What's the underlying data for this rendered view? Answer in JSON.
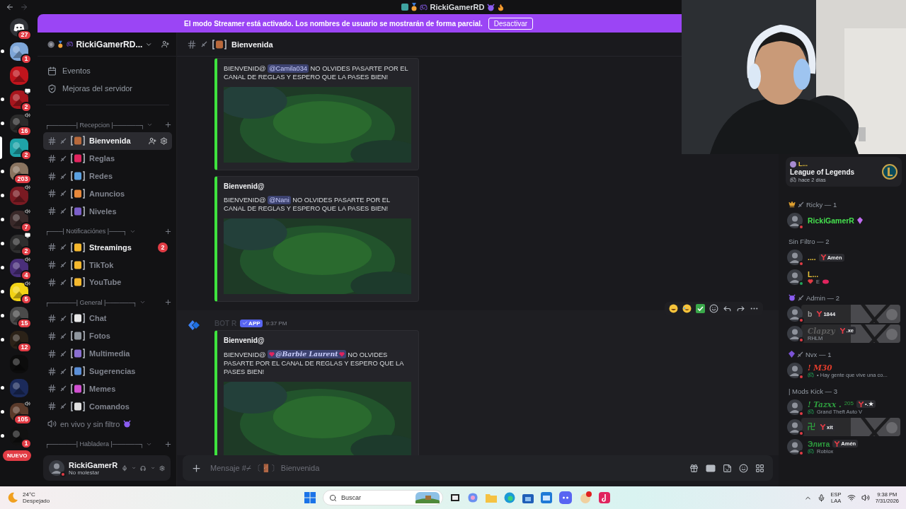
{
  "window": {
    "title": "RickiGamerRD"
  },
  "servers": [
    {
      "kind": "home",
      "badge": "27",
      "unread": false,
      "selected": false,
      "speaker": false,
      "screen": false,
      "color": "#313338"
    },
    {
      "kind": "server",
      "badge": "1",
      "unread": true,
      "selected": false,
      "speaker": false,
      "screen": false,
      "color": "#7ea6d8"
    },
    {
      "kind": "server",
      "unread": false,
      "selected": false,
      "speaker": false,
      "screen": false,
      "color": "#c0141c"
    },
    {
      "kind": "server",
      "badge": "2",
      "unread": true,
      "selected": false,
      "speaker": false,
      "screen": true,
      "color": "#a8161e"
    },
    {
      "kind": "server",
      "badge": "16",
      "unread": true,
      "selected": false,
      "speaker": true,
      "screen": false,
      "color": "#2a2a2a"
    },
    {
      "kind": "server",
      "badge": "2",
      "unread": false,
      "selected": true,
      "speaker": false,
      "screen": false,
      "color": "#1fa3a8"
    },
    {
      "kind": "server",
      "badge": "203",
      "unread": true,
      "selected": false,
      "speaker": false,
      "screen": false,
      "color": "#8a7460"
    },
    {
      "kind": "server",
      "unread": true,
      "selected": false,
      "speaker": true,
      "screen": false,
      "color": "#7a1a22"
    },
    {
      "kind": "server",
      "badge": "7",
      "unread": true,
      "selected": false,
      "speaker": true,
      "screen": false,
      "color": "#3a2a2a"
    },
    {
      "kind": "server",
      "badge": "2",
      "unread": true,
      "selected": false,
      "speaker": false,
      "screen": true,
      "color": "#2e2e2e"
    },
    {
      "kind": "server",
      "badge": "4",
      "unread": true,
      "selected": false,
      "speaker": true,
      "screen": false,
      "color": "#4a2f7a"
    },
    {
      "kind": "server",
      "badge": "5",
      "unread": true,
      "selected": false,
      "speaker": true,
      "screen": false,
      "color": "#f2d316"
    },
    {
      "kind": "server",
      "badge": "15",
      "unread": true,
      "selected": false,
      "speaker": false,
      "screen": false,
      "color": "#4a4a4a"
    },
    {
      "kind": "server",
      "badge": "12",
      "unread": true,
      "selected": false,
      "speaker": false,
      "screen": false,
      "color": "#2b2218"
    },
    {
      "kind": "server",
      "unread": false,
      "selected": false,
      "speaker": false,
      "screen": false,
      "color": "#0c0c0c"
    },
    {
      "kind": "server",
      "unread": true,
      "selected": false,
      "speaker": false,
      "screen": false,
      "color": "#1b2a5a"
    },
    {
      "kind": "server",
      "badge": "105",
      "unread": true,
      "selected": false,
      "speaker": true,
      "screen": false,
      "color": "#5a3a2a"
    },
    {
      "kind": "server",
      "badge": "1",
      "unread": true,
      "selected": false,
      "speaker": false,
      "screen": false,
      "color": "#111111"
    }
  ],
  "new_label": "NUEVO",
  "banner": {
    "text": "El modo Streamer está activado. Los nombres de usuario se mostrarán de forma parcial.",
    "button": "Desactivar"
  },
  "server_header": {
    "name": "RickiGamerRD..."
  },
  "nav": [
    {
      "kind": "events",
      "label": "Eventos"
    },
    {
      "kind": "boost",
      "label": "Mejoras del servidor"
    }
  ],
  "categories": [
    {
      "label": "┌──────| Recepcion |──────┐",
      "expanded": true,
      "channels": [
        {
          "kind": "text",
          "name": "Bienvenida",
          "color": "#b8693c",
          "selected": true,
          "unread": false
        },
        {
          "kind": "text",
          "name": "Reglas",
          "color": "#e0245e",
          "selected": false,
          "unread": false
        },
        {
          "kind": "text",
          "name": "Redes",
          "color": "#5aa0e0",
          "selected": false,
          "unread": false
        },
        {
          "kind": "text",
          "name": "Anuncios",
          "color": "#e8893b",
          "selected": false,
          "unread": false
        },
        {
          "kind": "text",
          "name": "Niveles",
          "color": "#7b5fc9",
          "selected": false,
          "unread": false
        }
      ]
    },
    {
      "label": "┌───| Notificaciónes |───┐",
      "expanded": true,
      "channels": [
        {
          "kind": "text",
          "name": "Streamings",
          "color": "#f5b82e",
          "selected": false,
          "unread": true,
          "badge": "2"
        },
        {
          "kind": "text",
          "name": "TikTok",
          "color": "#f5b82e",
          "selected": false,
          "unread": false
        },
        {
          "kind": "text",
          "name": "YouTube",
          "color": "#f5b82e",
          "selected": false,
          "unread": false
        }
      ]
    },
    {
      "label": "┌──────| General |──────┐",
      "expanded": true,
      "channels": [
        {
          "kind": "text",
          "name": "Chat",
          "color": "#e8e8e8",
          "selected": false,
          "unread": false
        },
        {
          "kind": "text",
          "name": "Fotos",
          "color": "#8f969e",
          "selected": false,
          "unread": false
        },
        {
          "kind": "text",
          "name": "Multimedia",
          "color": "#8a6fd1",
          "selected": false,
          "unread": false
        },
        {
          "kind": "text",
          "name": "Sugerencias",
          "color": "#5b8fd8",
          "selected": false,
          "unread": false
        },
        {
          "kind": "text",
          "name": "Memes",
          "color": "#d04fd0",
          "selected": false,
          "unread": false
        },
        {
          "kind": "text",
          "name": "Comandos",
          "color": "#e0e0e0",
          "selected": false,
          "unread": false
        },
        {
          "kind": "voice",
          "name": "en vivo y sin filtro",
          "selected": false,
          "unread": false
        }
      ]
    },
    {
      "label": "┌──────| Habladera |──────┐",
      "expanded": true
    }
  ],
  "user_panel": {
    "name": "RickiGamerR",
    "status": "No molestar"
  },
  "chat_header": {
    "channel": "Bienvenida"
  },
  "messages": [
    {
      "kind": "continuation",
      "hovered": false,
      "embed": {
        "text": {
          "before": "BIENVENID@ ",
          "mention": "@Camila034",
          "after": " NO OLVIDES PASARTE POR EL CANAL DE REGLAS Y ESPERO QUE LA PASES BIEN!",
          "hearts": false
        }
      }
    },
    {
      "kind": "continuation",
      "hovered": false,
      "embed": {
        "title": "Bienvenid@",
        "text": {
          "before": "BIENVENID@ ",
          "mention": "@Nani",
          "after": " NO OLVIDES PASARTE POR EL CANAL DE REGLAS Y ESPERO QUE LA PASES BIEN!",
          "hearts": false
        }
      }
    },
    {
      "kind": "full",
      "author": "BOT R",
      "tag": "APP",
      "time": "9:37 PM",
      "hovered": true,
      "embed": {
        "title": "Bienvenid@",
        "text": {
          "before": "BIENVENID@ ",
          "mention": "@Barbie Laurent",
          "after": " NO OLVIDES PASARTE POR EL CANAL DE REGLAS Y ESPERO QUE LA PASES BIEN!",
          "hearts": true
        }
      }
    }
  ],
  "input": {
    "placeholder": "Mensaje #⌿ 〔🚪〕 Bienvenida"
  },
  "activity_card": {
    "user": "L...",
    "game": "League of Legends",
    "time": "hace 2 días"
  },
  "member_groups": [
    {
      "kind": "crown",
      "label": "Ricky — 1",
      "members": [
        {
          "name": "RickiGamerR",
          "color": "#45e04e",
          "serif": false,
          "dnd": true,
          "boosting": true,
          "banner": false
        }
      ]
    },
    {
      "kind": "plain",
      "label": "Sin Filtro — 2",
      "members": [
        {
          "name": "....",
          "color": "#e8c33a",
          "serif": false,
          "dnd": true,
          "tag": "Amén",
          "banner": false
        },
        {
          "name": "L...",
          "color": "#e8c33a",
          "serif": false,
          "dnd": false,
          "subtitle": {
            "kind": "emoji",
            "text": "E"
          },
          "banner": false
        }
      ]
    },
    {
      "kind": "devil",
      "label": "Admin — 2",
      "members": [
        {
          "name": "b",
          "color": "#9a9a9a",
          "serif": false,
          "dnd": true,
          "tag": "1844",
          "banner": true
        },
        {
          "name": "Clapzy",
          "color": "#5e5e5e",
          "serif": true,
          "dnd": true,
          "tag": ".xe",
          "subtitle": {
            "kind": "plain",
            "text": "RHLM"
          },
          "banner": true
        }
      ]
    },
    {
      "kind": "gem",
      "label": "Nvx — 1",
      "members": [
        {
          "name": "! M30",
          "color": "#e03c2c",
          "serif": true,
          "dnd": true,
          "subtitle": {
            "kind": "game",
            "text": "• Hay gente que vive una co..."
          },
          "banner": false
        }
      ]
    },
    {
      "kind": "plain",
      "label": "| Mods Kick — 3",
      "members": [
        {
          "name": "! Tazxx .",
          "color": "#2e9e3f",
          "serif": true,
          "dnd": true,
          "sup": "205",
          "tag": "•.★",
          "subtitle": {
            "kind": "game",
            "text": "Grand Theft Auto V"
          },
          "banner": false
        },
        {
          "name": "卍",
          "color": "#2e9e3f",
          "serif": false,
          "dnd": true,
          "tag": "xit",
          "banner": true
        },
        {
          "name": "Элита",
          "color": "#2e9e3f",
          "serif": false,
          "dnd": true,
          "tag": "Amén",
          "subtitle": {
            "kind": "game",
            "text": "Roblox"
          },
          "banner": false
        }
      ]
    }
  ],
  "taskbar": {
    "temp": "24°C",
    "weather": "Despejado",
    "search": "Buscar",
    "lang": "ESP",
    "region": "LAA",
    "time": "9:38 PM",
    "date": "7/31/2026"
  }
}
